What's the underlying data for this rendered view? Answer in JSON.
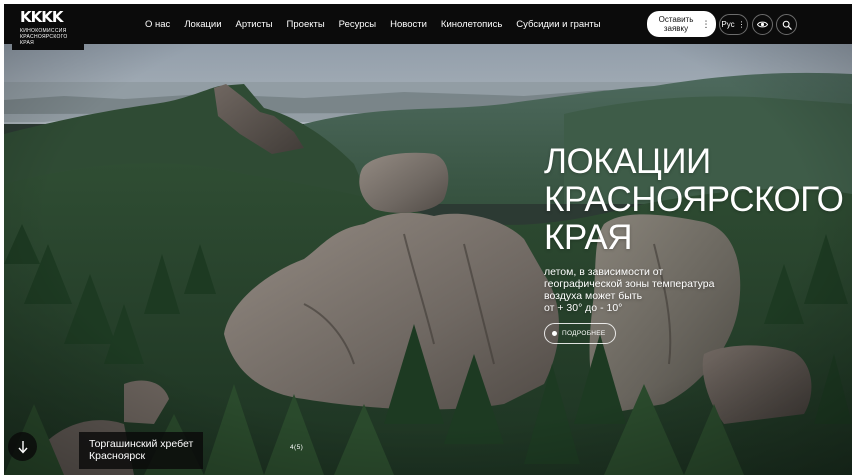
{
  "header": {
    "logo": {
      "mark": "KKKK",
      "lines": [
        "КИНОКОМИССИЯ",
        "КРАСНОЯРСКОГО",
        "КРАЯ"
      ]
    },
    "nav": [
      "О нас",
      "Локации",
      "Артисты",
      "Проекты",
      "Ресурсы",
      "Новости",
      "Кинолетопись",
      "Субсидии и гранты"
    ],
    "cta": {
      "line1": "Оставить",
      "line2": "заявку",
      "more": "⋮"
    },
    "lang": {
      "label": "Рус",
      "more": "⋮"
    }
  },
  "hero": {
    "title_lines": [
      "ЛОКАЦИИ",
      "КРАСНОЯРСКОГО",
      "КРАЯ"
    ],
    "subtitle_lines": [
      "летом, в зависимости от",
      "географической зоны температура",
      "воздуха может быть",
      "от + 30° до - 10°"
    ],
    "more_label": "ПОДРОБНЕЕ"
  },
  "slide": {
    "caption_lines": [
      "Торгашинский хребет",
      "Красноярск"
    ],
    "counter": "4(5)"
  },
  "colors": {
    "bar": "#0b0b0b",
    "forest": "#2d4a2d",
    "rock": "#7a7470",
    "sky": "#9aa6b3"
  }
}
